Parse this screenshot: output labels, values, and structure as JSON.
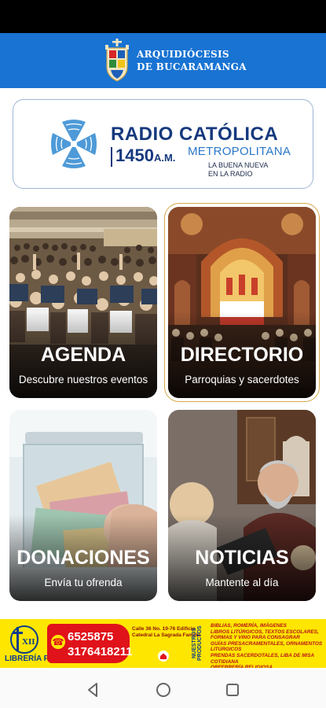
{
  "header": {
    "brand_line1": "ARQUIDIÓCESIS",
    "brand_line2": "DE BUCARAMANGA",
    "crest_icon": "archdiocese-crest-icon",
    "bar_color": "#1873d3"
  },
  "radio": {
    "title": "RADIO CATÓLICA",
    "frequency": "1450",
    "frequency_unit": "A.M.",
    "subtitle": "METROPOLITANA",
    "tagline": "LA BUENA NUEVA\nEN LA RADIO",
    "icon": "radio-broadcast-icon",
    "brand_color": "#16397d"
  },
  "tiles": [
    {
      "title": "AGENDA",
      "subtitle": "Descubre nuestros eventos",
      "image": "crowd-at-mass-photo"
    },
    {
      "title": "DIRECTORIO",
      "subtitle": "Parroquias y sacerdotes",
      "image": "cathedral-interior-photo"
    },
    {
      "title": "DONACIONES",
      "subtitle": "Envía tu ofrenda",
      "image": "money-jar-photo"
    },
    {
      "title": "NOTICIAS",
      "subtitle": "Mantente al día",
      "image": "people-reading-photo"
    }
  ],
  "ad": {
    "logo_text": "XII",
    "logo_name": "LIBRERÍA PIO XII",
    "phone1": "6525875",
    "phone2": "3176418211",
    "address": "Calle 36 No. 19-76 Edificio\nCatedral La Sagrada Familia",
    "vertical_label": "NUESTROS PRODUCTOS",
    "products": "BIBLIAS, ROMERÍA, IMÁGENES\nLIBROS LITÚRGICOS, TEXTOS ESCOLARES,\nFORMAS Y VINO PARA CONSAGRAR\nGUÍAS PRESACRAMENTALES, ORNAMENTOS LITÚRGICOS\nPRENDAS SACERDOTALES, LIBA DE MISA COTIDIANA\nORFEBRERÍA RELIGIOSA",
    "accent_color": "#e0121a",
    "background_color": "#ffe600"
  },
  "nav": {
    "back_icon": "back-triangle-icon",
    "home_icon": "home-circle-icon",
    "recents_icon": "recents-square-icon"
  }
}
